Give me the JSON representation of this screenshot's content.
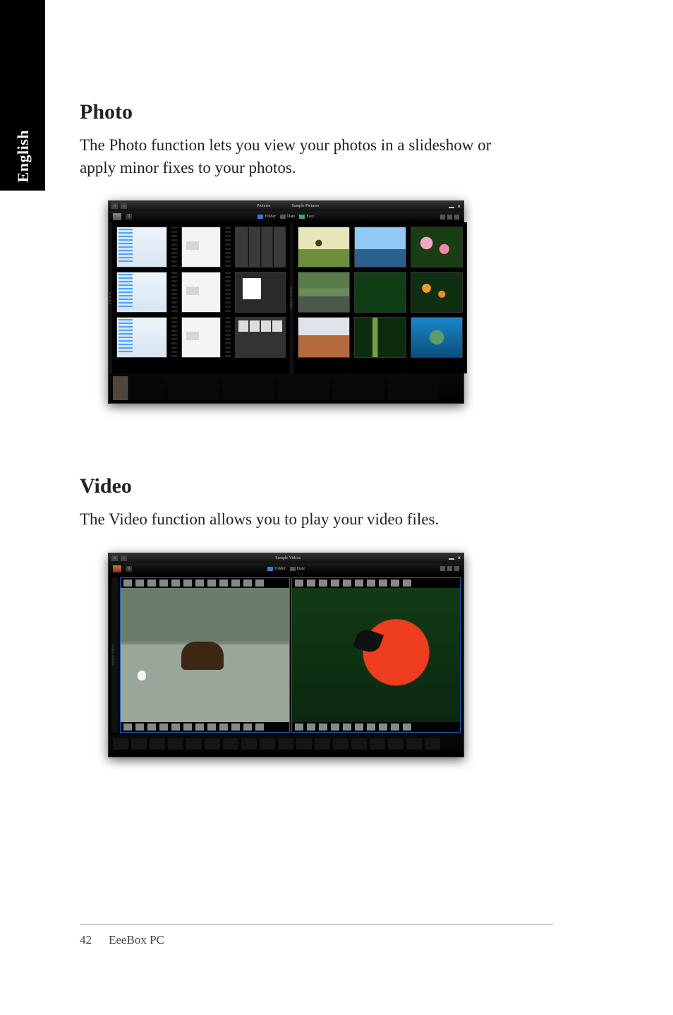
{
  "page": {
    "language_tab": "English",
    "number": "42",
    "product": "EeeBox PC"
  },
  "sections": {
    "photo": {
      "title": "Photo",
      "body": "The Photo function lets you view your photos in a slideshow or apply minor fixes to your photos."
    },
    "video": {
      "title": "Video",
      "body": "The Video function allows you to play your video files."
    }
  },
  "photo_app": {
    "titlebar": {
      "center": "Pictures",
      "right_tab": "Sample Pictures"
    },
    "toolbar": {
      "folder": "Folder",
      "date": "Date",
      "face": "Face"
    },
    "side_labels": {
      "left": "Pictures",
      "right": "Sample Pictures"
    }
  },
  "video_app": {
    "titlebar": {
      "center": "Sample Videos"
    },
    "toolbar": {
      "folder": "Folder",
      "date": "Date"
    },
    "side_label": "Sample Videos"
  }
}
